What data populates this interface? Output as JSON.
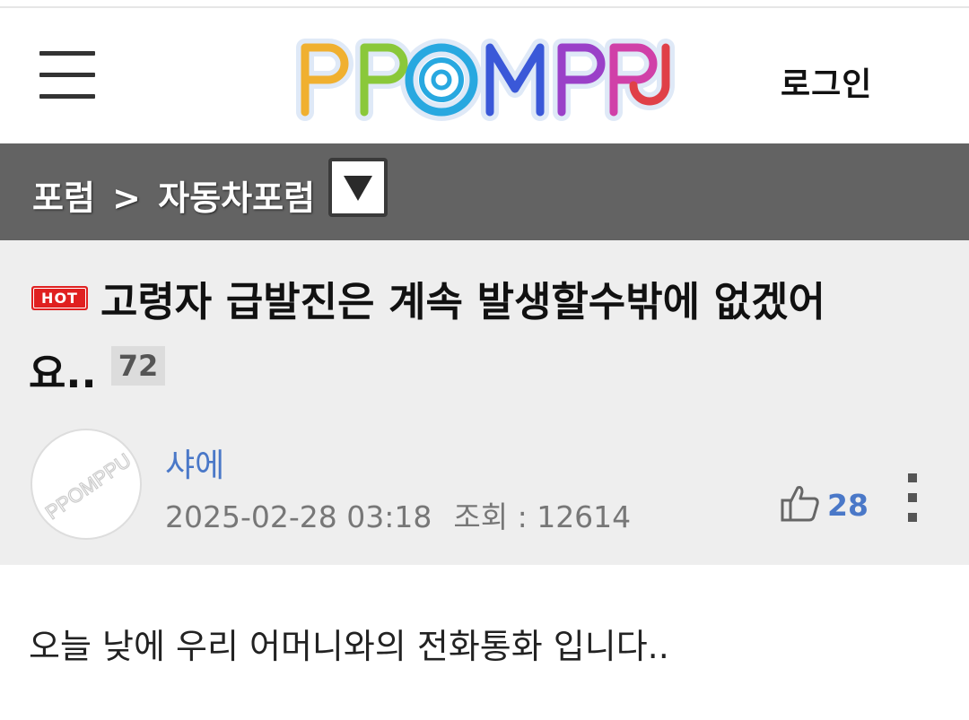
{
  "header": {
    "logo_text": "PPOMPPU",
    "login_label": "로그인",
    "menu_icon": "hamburger-icon"
  },
  "breadcrumb": {
    "forum": "포럼",
    "separator": ">",
    "board": "자동차포럼",
    "dropdown_icon": "triangle-down-icon"
  },
  "post": {
    "badge": "HOT",
    "title_line1": "고령자 급발진은 계속 발생할수밖에 없겠어",
    "title_line2": "요..",
    "comment_count": "72",
    "author": "샤에",
    "datetime": "2025-02-28 03:18",
    "views": "조회 : 12614",
    "likes": "28",
    "like_icon": "thumbs-up-icon",
    "more_icon": "more-vertical-icon",
    "avatar_text": "PPOMPPU",
    "body": "오늘 낮에 우리 어머니와의 전화통화 입니다.."
  },
  "colors": {
    "breadcrumb_bg": "#636363",
    "title_bg": "#eeeeee",
    "hot_badge": "#e02020",
    "link_blue": "#4a78c8"
  }
}
